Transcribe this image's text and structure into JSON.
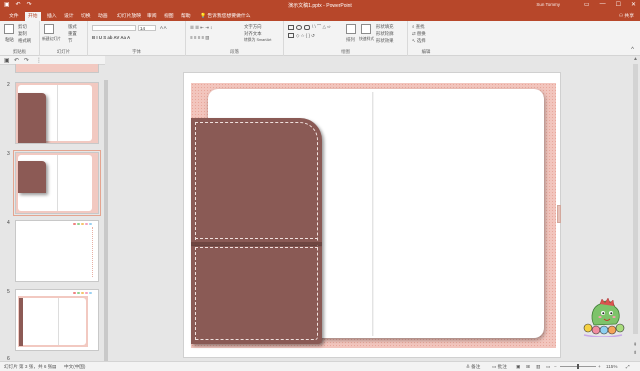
{
  "window": {
    "title": "演示文稿1.pptx  -  PowerPoint",
    "user": "Sun Tommy"
  },
  "tabs": [
    "文件",
    "开始",
    "插入",
    "设计",
    "切换",
    "动画",
    "幻灯片放映",
    "审阅",
    "视图",
    "帮助"
  ],
  "active_tab": "开始",
  "tell_me": "告诉我您想要做什么",
  "share": "共享",
  "ribbon": {
    "clipboard": {
      "label": "剪贴板",
      "paste": "粘贴",
      "cut": "剪切",
      "copy": "复制",
      "painter": "格式刷"
    },
    "slides": {
      "label": "幻灯片",
      "new_slide": "新建幻灯片",
      "layout": "版式",
      "reset": "重置",
      "section": "节"
    },
    "font": {
      "label": "字体",
      "size": "14"
    },
    "paragraph": {
      "label": "段落",
      "direction": "文字方向",
      "align": "对齐文本",
      "smartart": "转换为 SmartArt"
    },
    "drawing": {
      "label": "绘图",
      "arrange": "排列",
      "quick_styles": "快速样式",
      "fill": "形状填充",
      "outline": "形状轮廓",
      "effects": "形状效果"
    },
    "editing": {
      "label": "编辑",
      "find": "查找",
      "replace": "替换",
      "select": "选择"
    }
  },
  "thumbnails": [
    {
      "num": "2"
    },
    {
      "num": "3"
    },
    {
      "num": "4"
    },
    {
      "num": "5"
    },
    {
      "num": "6"
    }
  ],
  "status": {
    "slide_info": "幻灯片 第 3 张，共 6 张",
    "language": "中文(中国)",
    "notes": "备注",
    "comments": "批注",
    "zoom": "115%"
  }
}
